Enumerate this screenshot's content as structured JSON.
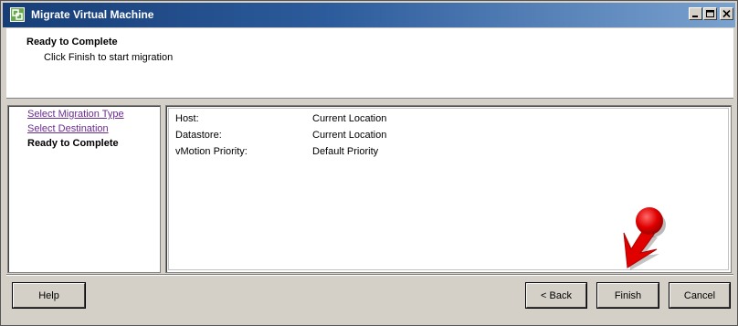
{
  "window": {
    "title": "Migrate Virtual Machine",
    "icon": "vmware-app-icon",
    "controls": [
      "minimize-icon",
      "maximize-icon",
      "close-icon"
    ]
  },
  "header": {
    "title": "Ready to Complete",
    "subtitle": "Click Finish to start migration"
  },
  "steps": {
    "items": [
      {
        "label": "Select Migration Type",
        "state": "completed"
      },
      {
        "label": "Select Destination",
        "state": "completed"
      },
      {
        "label": "Ready to Complete",
        "state": "current"
      }
    ]
  },
  "summary": {
    "rows": [
      {
        "label": "Host:",
        "value": "Current Location"
      },
      {
        "label": "Datastore:",
        "value": "Current Location"
      },
      {
        "label": "vMotion Priority:",
        "value": "Default Priority"
      }
    ]
  },
  "buttons": {
    "help": "Help",
    "back": "< Back",
    "finish": "Finish",
    "cancel": "Cancel"
  },
  "annotation": {
    "icon": "red-pointer-arrow",
    "color": "#e00000"
  },
  "colors": {
    "titlebar": "#163d76",
    "link": "#6a2d8f",
    "chrome": "#d4d0c8"
  }
}
